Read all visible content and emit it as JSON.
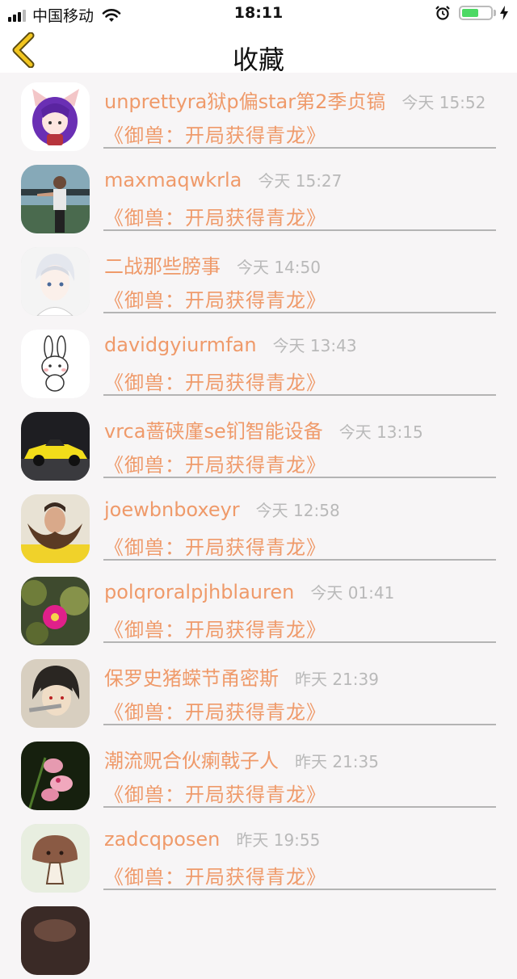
{
  "status_bar": {
    "carrier": "中国移动",
    "time": "18:11",
    "battery_level": 0.6
  },
  "nav": {
    "title": "收藏",
    "back_icon": "chevron-left-icon"
  },
  "favorites": [
    {
      "name": "unprettyra狱p偏star第2季贞镐",
      "time": "今天 15:52",
      "book": "《御兽：开局获得青龙》"
    },
    {
      "name": "maxmaqwkrla",
      "time": "今天 15:27",
      "book": "《御兽：开局获得青龙》"
    },
    {
      "name": "二战那些膀事",
      "time": "今天 14:50",
      "book": "《御兽：开局获得青龙》"
    },
    {
      "name": "davidgyiurmfan",
      "time": "今天 13:43",
      "book": "《御兽：开局获得青龙》"
    },
    {
      "name": "vrca蔷硖廑se钔智能设备",
      "time": "今天 13:15",
      "book": "《御兽：开局获得青龙》"
    },
    {
      "name": "joewbnboxeyr",
      "time": "今天 12:58",
      "book": "《御兽：开局获得青龙》"
    },
    {
      "name": "polqroralpjhblauren",
      "time": "今天 01:41",
      "book": "《御兽：开局获得青龙》"
    },
    {
      "name": "保罗史猪蝾节甬密斯",
      "time": "昨天 21:39",
      "book": "《御兽：开局获得青龙》"
    },
    {
      "name": "潮流贶合伙瘌戟子人",
      "time": "昨天 21:35",
      "book": "《御兽：开局获得青龙》"
    },
    {
      "name": "zadcqposen",
      "time": "昨天 19:55",
      "book": "《御兽：开局获得青龙》"
    },
    {
      "name": "",
      "time": "",
      "book": ""
    }
  ],
  "colors": {
    "accent": "#ef9a6a",
    "time_gray": "#b9b9b9",
    "back_arrow": "#f2c61f",
    "background": "#f7f5f6"
  }
}
